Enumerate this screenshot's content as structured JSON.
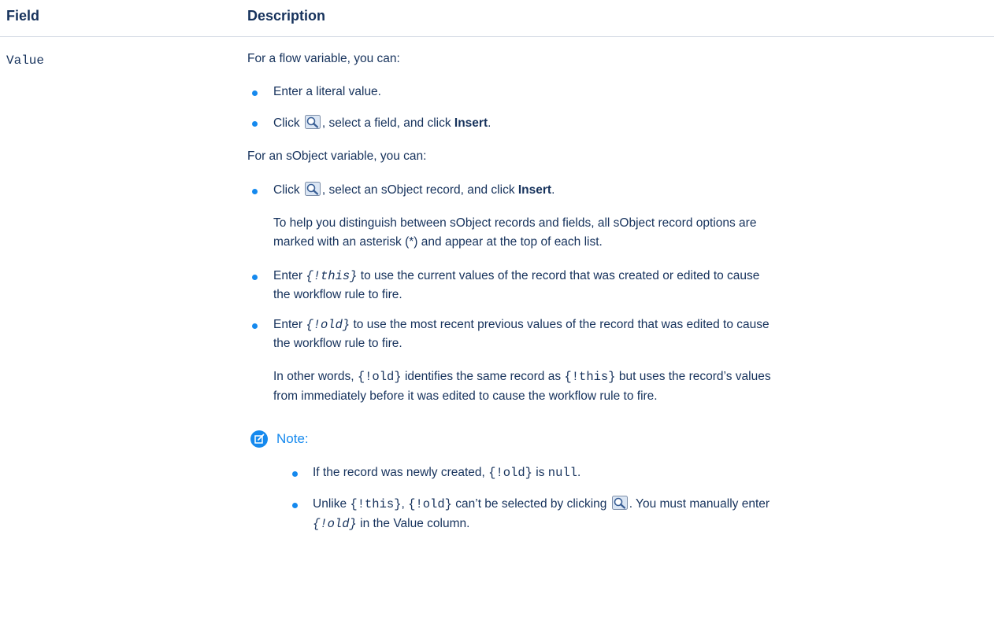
{
  "table": {
    "headers": {
      "field": "Field",
      "description": "Description"
    },
    "row": {
      "field": "Value",
      "flow_intro": "For a flow variable, you can:",
      "flow_bullets": {
        "b1": "Enter a literal value.",
        "b2_pre": "Click",
        "b2_mid": ", select a field, and click ",
        "b2_bold": "Insert",
        "b2_end": "."
      },
      "sobject_intro": "For an sObject variable, you can:",
      "sobject_bullets": {
        "b1_pre": "Click",
        "b1_mid": ", select an sObject record, and click ",
        "b1_bold": "Insert",
        "b1_end": ".",
        "b1_para_l1": "To help you distinguish between sObject records and fields, all sObject record options are",
        "b1_para_l2": "marked with an asterisk (*) and appear at the top of each list.",
        "b2_pre": "Enter ",
        "b2_code": "{!this}",
        "b2_post": " to use the current values of the record that was created or edited to cause",
        "b2_l2": "the workflow rule to fire.",
        "b3_pre": "Enter ",
        "b3_code": "{!old}",
        "b3_post": " to use the most recent previous values of the record that was edited to cause",
        "b3_l2": "the workflow rule to fire.",
        "b3_para_l1_pre": "In other words, ",
        "b3_para_l1_code1": "{!old}",
        "b3_para_l1_mid": " identifies the same record as ",
        "b3_para_l1_code2": "{!this}",
        "b3_para_l1_post": " but uses the record’s values",
        "b3_para_l2": "from immediately before it was edited to cause the workflow rule to fire."
      },
      "note": {
        "label": "Note:",
        "n1_pre": "If the record was newly created, ",
        "n1_code1": "{!old}",
        "n1_mid": " is ",
        "n1_code2": "null",
        "n1_end": ".",
        "n2_pre": "Unlike ",
        "n2_code1": "{!this}",
        "n2_comma": ", ",
        "n2_code2": "{!old}",
        "n2_mid": " can’t be selected by clicking",
        "n2_post": ". You must manually enter",
        "n2_l2_code": "{!old}",
        "n2_l2_post": " in the Value column."
      }
    }
  },
  "icons": {
    "lookup": "lookup-magnifier-icon",
    "note": "note-edit-icon"
  },
  "colors": {
    "text": "#16325c",
    "accent": "#1589ee",
    "rule": "#d8dde6"
  }
}
